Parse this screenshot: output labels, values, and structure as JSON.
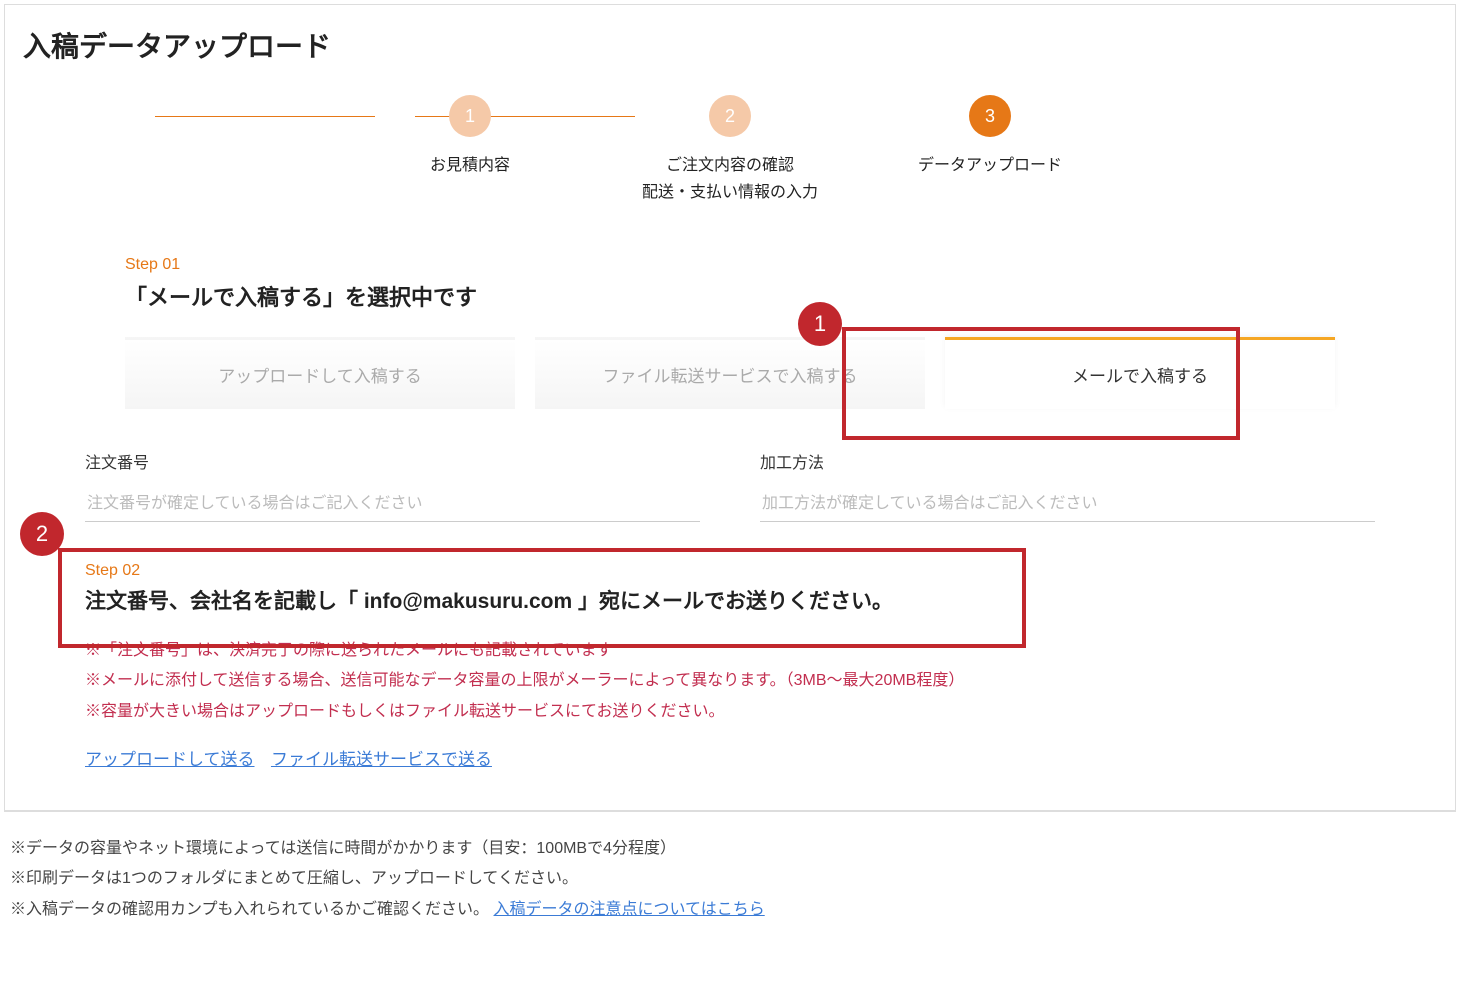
{
  "page_title": "入稿データアップロード",
  "stepper": {
    "steps": [
      {
        "num": "1",
        "label": "お見積内容",
        "active": false
      },
      {
        "num": "2",
        "label": "ご注文内容の確認\n配送・支払い情報の入力",
        "active": false
      },
      {
        "num": "3",
        "label": "データアップロード",
        "active": true
      }
    ]
  },
  "step01": {
    "small": "Step 01",
    "heading": "「メールで入稿する」を選択中です",
    "tabs": [
      {
        "label": "アップロードして入稿する",
        "active": false
      },
      {
        "label": "ファイル転送サービスで入稿する",
        "active": false
      },
      {
        "label": "メールで入稿する",
        "active": true
      }
    ]
  },
  "form": {
    "order_no": {
      "label": "注文番号",
      "placeholder": "注文番号が確定している場合はご記入ください"
    },
    "process": {
      "label": "加工方法",
      "placeholder": "加工方法が確定している場合はご記入ください"
    }
  },
  "step02": {
    "small": "Step 02",
    "heading": "注文番号、会社名を記載し「 info@makusuru.com 」宛にメールでお送りください。",
    "notes": [
      "※「注文番号」は、決済完了の際に送られたメールにも記載されています",
      "※メールに添付して送信する場合、送信可能なデータ容量の上限がメーラーによって異なります。（3MB〜最大20MB程度）",
      "※容量が大きい場合はアップロードもしくはファイル転送サービスにてお送りください。"
    ],
    "links": [
      {
        "label": "アップロードして送る"
      },
      {
        "label": "ファイル転送サービスで送る"
      }
    ]
  },
  "footer": {
    "lines": [
      "※データの容量やネット環境によっては送信に時間がかかります（目安：100MBで4分程度）",
      "※印刷データは1つのフォルダにまとめて圧縮し、アップロードしてください。"
    ],
    "line3_prefix": "※入稿データの確認用カンプも入れられているかご確認ください。",
    "line3_link": "入稿データの注意点についてはこちら"
  },
  "badges": {
    "b1": "1",
    "b2": "2"
  }
}
